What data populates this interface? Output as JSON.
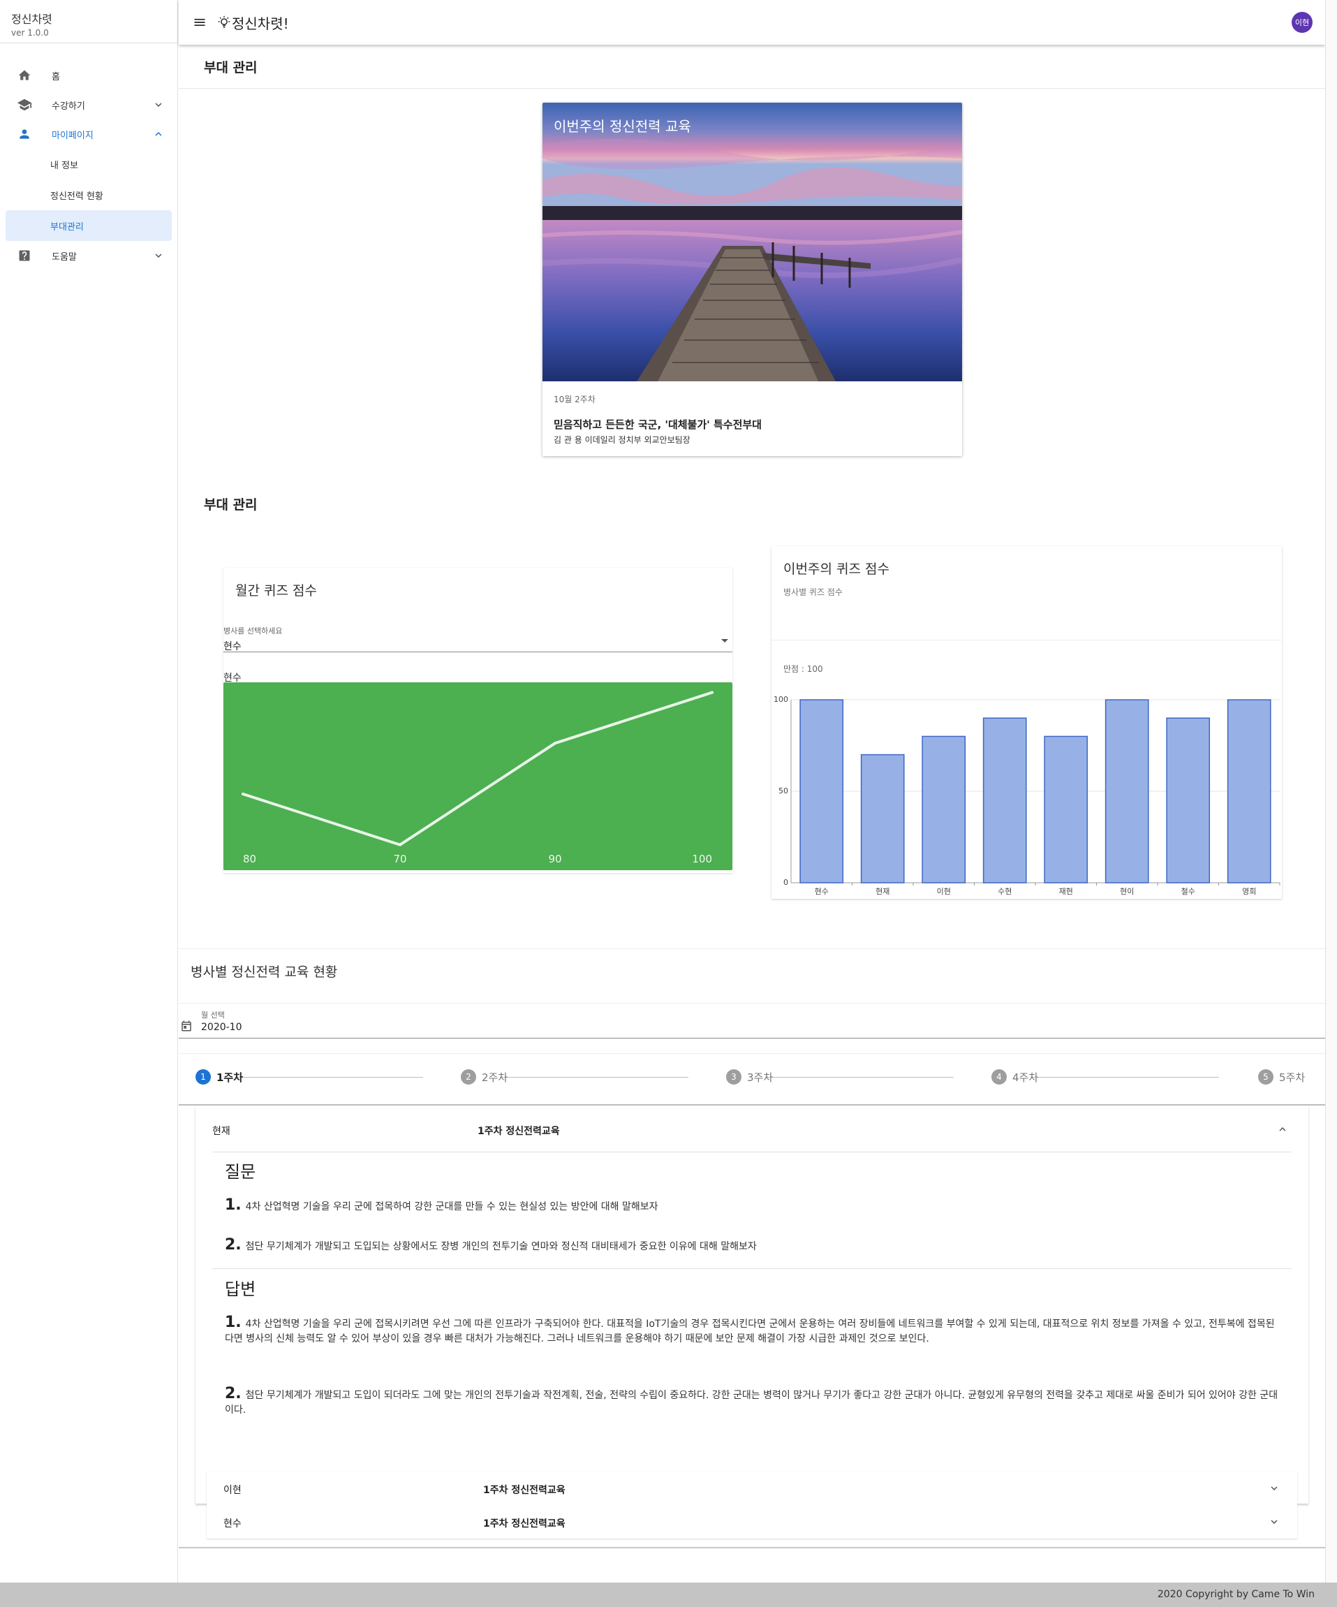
{
  "app": {
    "name": "정신차렷",
    "version": "ver 1.0.0",
    "logo_text": "정신차렷!",
    "avatar": "이현"
  },
  "sidebar": {
    "items": [
      {
        "label": "홈"
      },
      {
        "label": "수강하기"
      },
      {
        "label": "마이페이지"
      },
      {
        "label": "도움말"
      }
    ],
    "sub_items": [
      {
        "label": "내 정보"
      },
      {
        "label": "정신전력 현황"
      },
      {
        "label": "부대관리"
      }
    ]
  },
  "page": {
    "title": "부대 관리",
    "section_title": "부대 관리"
  },
  "news": {
    "caption": "이번주의 정신전력 교육",
    "week": "10월 2주차",
    "headline": "믿음직하고 든든한 국군, '대체불가' 특수전부대",
    "author": "김 관 용 이데일리 정치부 외교안보팀장"
  },
  "monthly": {
    "title": "월간 퀴즈 점수",
    "select_label": "병사를 선택하세요",
    "select_value": "현수",
    "chart_label": "현수"
  },
  "weekly": {
    "title": "이번주의 퀴즈 점수",
    "subtitle": "병사별 퀴즈 점수",
    "max_label": "만점 : 100"
  },
  "chart_data": [
    {
      "type": "line",
      "x": [
        "80",
        "70",
        "90",
        "100"
      ],
      "series": [
        {
          "values": [
            80,
            70,
            90,
            100
          ]
        }
      ],
      "ylim": [
        65,
        102
      ],
      "grid": false,
      "background": "#4caf50",
      "line_color": "#e8f5e9"
    },
    {
      "type": "bar",
      "categories": [
        "현수",
        "현재",
        "이현",
        "수현",
        "재현",
        "현이",
        "철수",
        "영희"
      ],
      "values": [
        100,
        70,
        80,
        90,
        80,
        100,
        90,
        100
      ],
      "yticks": [
        "0",
        "50",
        "100"
      ],
      "ylim": [
        0,
        100
      ],
      "grid": true,
      "bar_color": "#97b1e6",
      "bar_border": "#3d66c4"
    }
  ],
  "education": {
    "title": "병사별 정신전력 교육 현황",
    "month_label": "월 선택",
    "month_value": "2020-10",
    "steps": [
      {
        "num": "1",
        "label": "1주차"
      },
      {
        "num": "2",
        "label": "2주차"
      },
      {
        "num": "3",
        "label": "3주차"
      },
      {
        "num": "4",
        "label": "4주차"
      },
      {
        "num": "5",
        "label": "5주차"
      }
    ],
    "open_panel": {
      "name": "현재",
      "title": "1주차 정신전력교육",
      "question_header": "질문",
      "questions": [
        {
          "n": "1.",
          "text": "4차 산업혁명 기술을 우리 군에 접목하여 강한 군대를 만들 수 있는 현실성 있는 방안에 대해 말해보자"
        },
        {
          "n": "2.",
          "text": "첨단 무기체계가 개발되고 도입되는 상황에서도 장병 개인의 전투기술 연마와 정신적 대비태세가 중요한 이유에 대해 말해보자"
        }
      ],
      "answer_header": "답변",
      "answers": [
        {
          "n": "1.",
          "text": "4차 산업혁명 기술을 우리 군에 접목시키려면 우선 그에 따른 인프라가 구축되어야 한다. 대표적을 IoT기술의 경우 접목시킨다면 군에서 운용하는 여러 장비들에 네트워크를 부여할 수 있게 되는데, 대표적으로 위치 정보를 가져올 수 있고, 전투복에 접목된다면 병사의 신체 능력도 알 수 있어 부상이 있을 경우 빠른 대처가 가능해진다. 그러나 네트워크를 운용해야 하기 때문에 보안 문제 해결이 가장 시급한 과제인 것으로 보인다."
        },
        {
          "n": "2.",
          "text": "첨단 무기체계가 개발되고 도입이 되더라도 그에 맞는 개인의 전투기술과 작전계획, 전술, 전략의 수립이 중요하다. 강한 군대는 병력이 많거나 무기가 좋다고 강한 군대가 아니다. 균형있게 유무형의 전력을 갖추고 제대로 싸울 준비가 되어 있어야 강한 군대이다."
        }
      ]
    },
    "closed_panels": [
      {
        "name": "이현",
        "title": "1주차 정신전력교육"
      },
      {
        "name": "현수",
        "title": "1주차 정신전력교육"
      }
    ]
  },
  "footer": {
    "text": "2020 Copyright by Came To Win"
  }
}
